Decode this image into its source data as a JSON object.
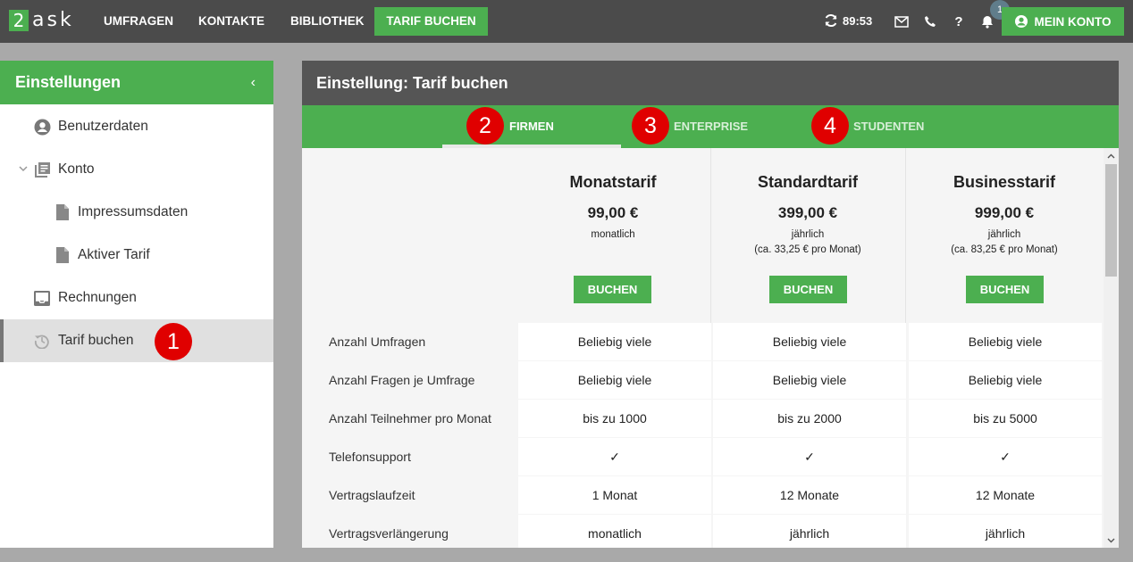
{
  "topbar": {
    "logo_number": "2",
    "logo_text": "ask",
    "nav": [
      "UMFRAGEN",
      "KONTAKTE",
      "BIBLIOTHEK"
    ],
    "cta": "TARIF BUCHEN",
    "timer": "89:53",
    "notification_count": "1",
    "account": "MEIN KONTO"
  },
  "sidebar": {
    "title": "Einstellungen",
    "collapse": "‹",
    "items": [
      {
        "label": "Benutzerdaten",
        "icon": "user-circle-icon"
      },
      {
        "label": "Konto",
        "icon": "library-icon"
      },
      {
        "label": "Impressumsdaten",
        "icon": "file-icon"
      },
      {
        "label": "Aktiver Tarif",
        "icon": "file-icon"
      },
      {
        "label": "Rechnungen",
        "icon": "inbox-icon"
      },
      {
        "label": "Tarif buchen",
        "icon": "history-icon"
      }
    ]
  },
  "markers": [
    "1",
    "2",
    "3",
    "4"
  ],
  "main": {
    "title": "Einstellung: Tarif buchen",
    "tabs": [
      "FIRMEN",
      "ENTERPRISE",
      "STUDENTEN"
    ],
    "active_tab": "FIRMEN"
  },
  "plans": [
    {
      "name": "Monatstarif",
      "price": "99,00 €",
      "period": "monatlich",
      "note": "",
      "button": "BUCHEN"
    },
    {
      "name": "Standardtarif",
      "price": "399,00 €",
      "period": "jährlich",
      "note": "(ca. 33,25 € pro Monat)",
      "button": "BUCHEN"
    },
    {
      "name": "Businesstarif",
      "price": "999,00 €",
      "period": "jährlich",
      "note": "(ca. 83,25 € pro Monat)",
      "button": "BUCHEN"
    }
  ],
  "features": [
    {
      "label": "Anzahl Umfragen",
      "values": [
        "Beliebig viele",
        "Beliebig viele",
        "Beliebig viele"
      ]
    },
    {
      "label": "Anzahl Fragen je Umfrage",
      "values": [
        "Beliebig viele",
        "Beliebig viele",
        "Beliebig viele"
      ]
    },
    {
      "label": "Anzahl Teilnehmer pro Monat",
      "values": [
        "bis zu 1000",
        "bis zu 2000",
        "bis zu 5000"
      ]
    },
    {
      "label": "Telefonsupport",
      "values": [
        "✓",
        "✓",
        "✓"
      ]
    },
    {
      "label": "Vertragslaufzeit",
      "values": [
        "1 Monat",
        "12 Monate",
        "12 Monate"
      ]
    },
    {
      "label": "Vertragsverlängerung",
      "values": [
        "monatlich",
        "jährlich",
        "jährlich"
      ]
    }
  ],
  "colors": {
    "brand": "#4caf50",
    "topbar": "#4b4b4b",
    "marker": "#e00000"
  }
}
